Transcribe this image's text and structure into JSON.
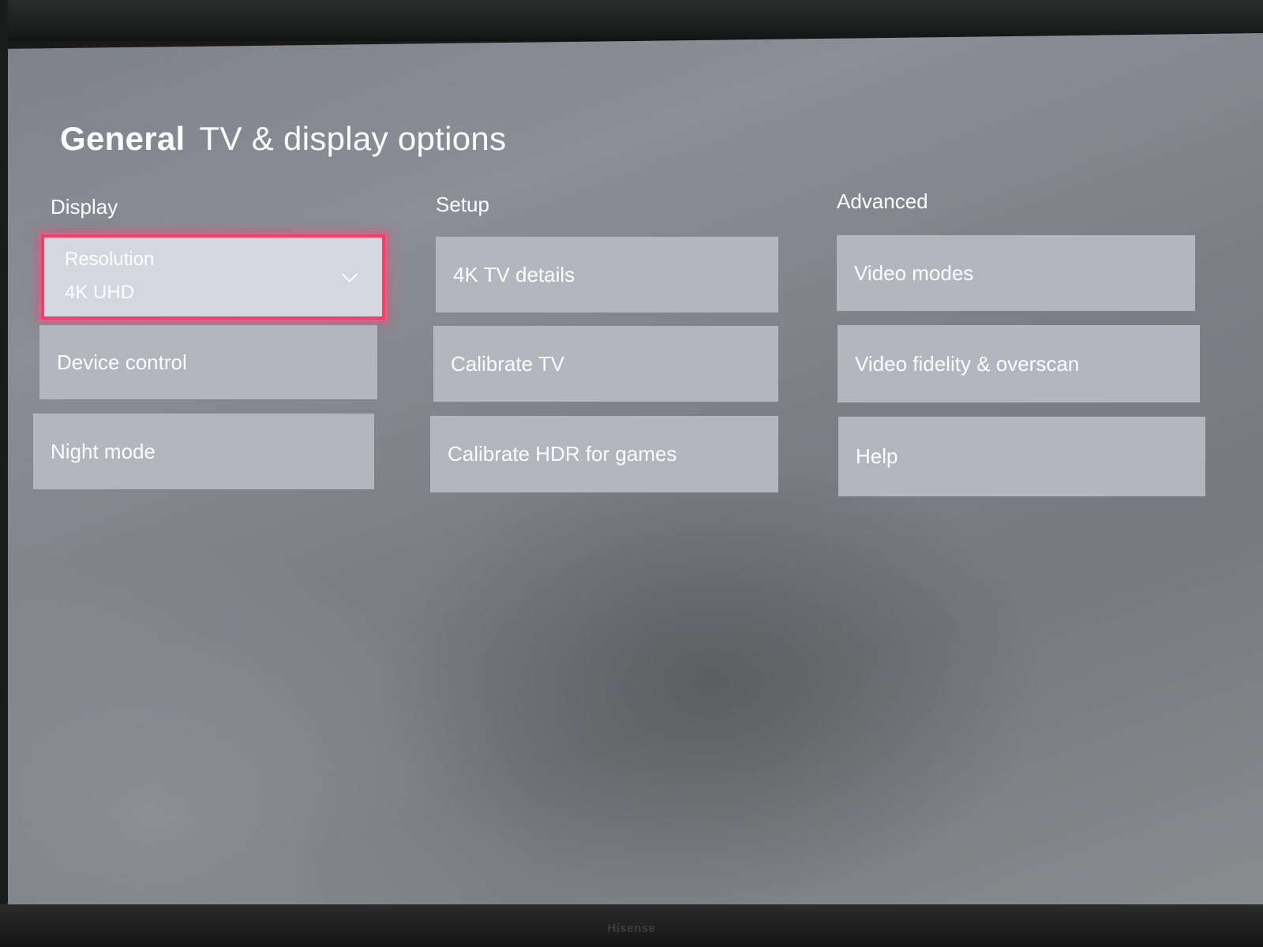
{
  "header": {
    "section": "General",
    "title": "TV & display options"
  },
  "columns": [
    {
      "heading": "Display",
      "items": [
        {
          "label": "Resolution",
          "value": "4K UHD"
        },
        {
          "label": "Device control"
        },
        {
          "label": "Night mode"
        }
      ]
    },
    {
      "heading": "Setup",
      "items": [
        {
          "label": "4K TV details"
        },
        {
          "label": "Calibrate TV"
        },
        {
          "label": "Calibrate HDR for games"
        }
      ]
    },
    {
      "heading": "Advanced",
      "items": [
        {
          "label": "Video modes"
        },
        {
          "label": "Video fidelity & overscan"
        },
        {
          "label": "Help"
        }
      ]
    }
  ],
  "tv_brand": "Hisense",
  "colors": {
    "focus": "#f0406a",
    "tile": "#b3b5bf",
    "tile_selected": "#d5d7e0"
  }
}
